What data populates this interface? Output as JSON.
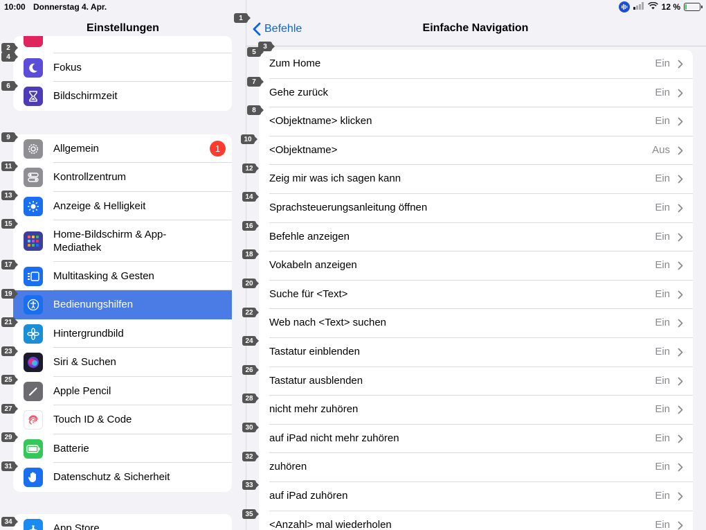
{
  "status": {
    "time": "10:00",
    "date": "Donnerstag 4. Apr.",
    "battery": "12 %",
    "battery_level": 0.12
  },
  "sidebar": {
    "title": "Einstellungen",
    "group1": [
      {
        "label": "Fokus"
      },
      {
        "label": "Bildschirmzeit"
      }
    ],
    "group2": [
      {
        "label": "Allgemein",
        "badge": "1"
      },
      {
        "label": "Kontrollzentrum"
      },
      {
        "label": "Anzeige & Helligkeit"
      },
      {
        "label": "Home-Bildschirm & App-Mediathek"
      },
      {
        "label": "Multitasking & Gesten"
      },
      {
        "label": "Bedienungshilfen"
      },
      {
        "label": "Hintergrundbild"
      },
      {
        "label": "Siri & Suchen"
      },
      {
        "label": "Apple Pencil"
      },
      {
        "label": "Touch ID & Code"
      },
      {
        "label": "Batterie"
      },
      {
        "label": "Datenschutz & Sicherheit"
      }
    ],
    "group3": [
      {
        "label": "App Store"
      }
    ]
  },
  "detail": {
    "back_label": "Befehle",
    "title": "Einfache Navigation",
    "commands": [
      {
        "label": "Zum Home",
        "value": "Ein"
      },
      {
        "label": "Gehe zurück",
        "value": "Ein"
      },
      {
        "label": "<Objektname> klicken",
        "value": "Ein"
      },
      {
        "label": "<Objektname>",
        "value": "Aus"
      },
      {
        "label": "Zeig mir was ich sagen kann",
        "value": "Ein"
      },
      {
        "label": "Sprachsteuerungsanleitung öffnen",
        "value": "Ein"
      },
      {
        "label": "Befehle anzeigen",
        "value": "Ein"
      },
      {
        "label": "Vokabeln anzeigen",
        "value": "Ein"
      },
      {
        "label": "Suche für <Text>",
        "value": "Ein"
      },
      {
        "label": "Web nach <Text> suchen",
        "value": "Ein"
      },
      {
        "label": "Tastatur einblenden",
        "value": "Ein"
      },
      {
        "label": "Tastatur ausblenden",
        "value": "Ein"
      },
      {
        "label": "nicht mehr zuhören",
        "value": "Ein"
      },
      {
        "label": "auf iPad nicht mehr zuhören",
        "value": "Ein"
      },
      {
        "label": "zuhören",
        "value": "Ein"
      },
      {
        "label": "auf iPad zuhören",
        "value": "Ein"
      },
      {
        "label": "<Anzahl> mal wiederholen",
        "value": "Ein"
      }
    ]
  },
  "markers": [
    "1",
    "2",
    "3",
    "4",
    "5",
    "6",
    "7",
    "8",
    "9",
    "10",
    "11",
    "12",
    "13",
    "14",
    "15",
    "16",
    "17",
    "18",
    "19",
    "20",
    "21",
    "22",
    "23",
    "24",
    "25",
    "26",
    "27",
    "28",
    "29",
    "30",
    "31",
    "32",
    "33",
    "34",
    "35"
  ],
  "colors": {
    "accent": "#0a63e8",
    "selected": "#4b7be5",
    "badge": "#ff3b30",
    "battery": "#34c759"
  }
}
